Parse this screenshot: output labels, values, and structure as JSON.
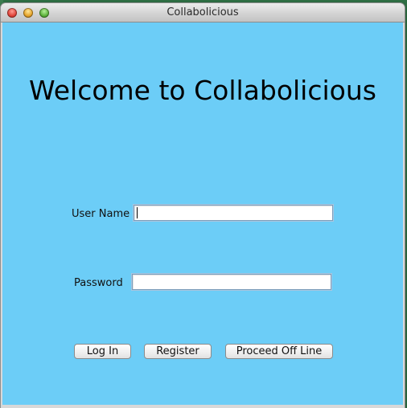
{
  "window": {
    "title": "Collabolicious",
    "controls": [
      "close",
      "minimize",
      "zoom"
    ]
  },
  "main": {
    "heading": "Welcome to Collabolicious",
    "username": {
      "label": "User Name",
      "value": ""
    },
    "password": {
      "label": "Password",
      "value": ""
    },
    "buttons": {
      "login": "Log In",
      "register": "Register",
      "offline": "Proceed Off Line"
    }
  },
  "colors": {
    "content_background": "#6ccdf7"
  }
}
